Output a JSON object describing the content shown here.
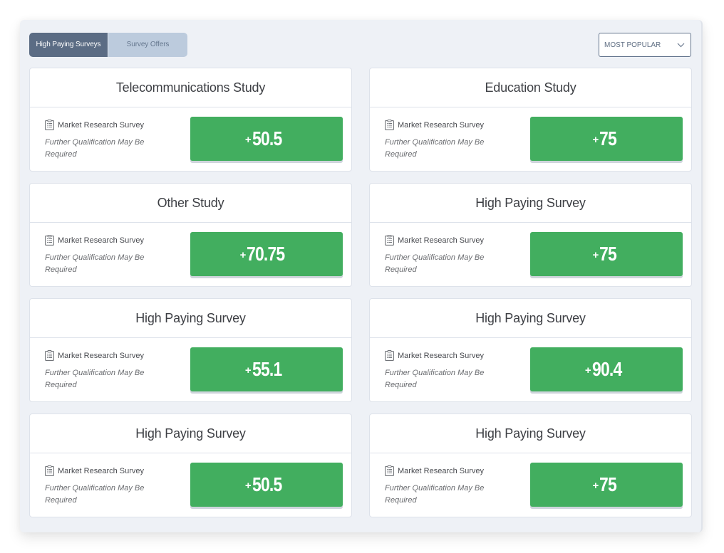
{
  "tabs": [
    {
      "label": "High Paying Surveys",
      "active": true
    },
    {
      "label": "Survey Offers",
      "active": false
    }
  ],
  "sort": {
    "selected": "MOST POPULAR",
    "icon": "chevron-down-icon"
  },
  "colors": {
    "accent_green": "#42ae5f",
    "tab_active": "#5b6c84",
    "tab_inactive": "#bccbdd",
    "panel_bg": "#eef1f6"
  },
  "surveys": [
    {
      "title": "Telecommunications Study",
      "type": "Market Research Survey",
      "type_icon": "clipboard-list-icon",
      "note": "Further Qualification May Be Required",
      "plus": "+",
      "points": "50.5"
    },
    {
      "title": "Education Study",
      "type": "Market Research Survey",
      "type_icon": "clipboard-list-icon",
      "note": "Further Qualification May Be Required",
      "plus": "+",
      "points": "75"
    },
    {
      "title": "Other Study",
      "type": "Market Research Survey",
      "type_icon": "clipboard-list-icon",
      "note": "Further Qualification May Be Required",
      "plus": "+",
      "points": "70.75"
    },
    {
      "title": "High Paying Survey",
      "type": "Market Research Survey",
      "type_icon": "clipboard-list-icon",
      "note": "Further Qualification May Be Required",
      "plus": "+",
      "points": "75"
    },
    {
      "title": "High Paying Survey",
      "type": "Market Research Survey",
      "type_icon": "clipboard-list-icon",
      "note": "Further Qualification May Be Required",
      "plus": "+",
      "points": "55.1"
    },
    {
      "title": "High Paying Survey",
      "type": "Market Research Survey",
      "type_icon": "clipboard-list-icon",
      "note": "Further Qualification May Be Required",
      "plus": "+",
      "points": "90.4"
    },
    {
      "title": "High Paying Survey",
      "type": "Market Research Survey",
      "type_icon": "clipboard-list-icon",
      "note": "Further Qualification May Be Required",
      "plus": "+",
      "points": "50.5"
    },
    {
      "title": "High Paying Survey",
      "type": "Market Research Survey",
      "type_icon": "clipboard-list-icon",
      "note": "Further Qualification May Be Required",
      "plus": "+",
      "points": "75"
    }
  ]
}
